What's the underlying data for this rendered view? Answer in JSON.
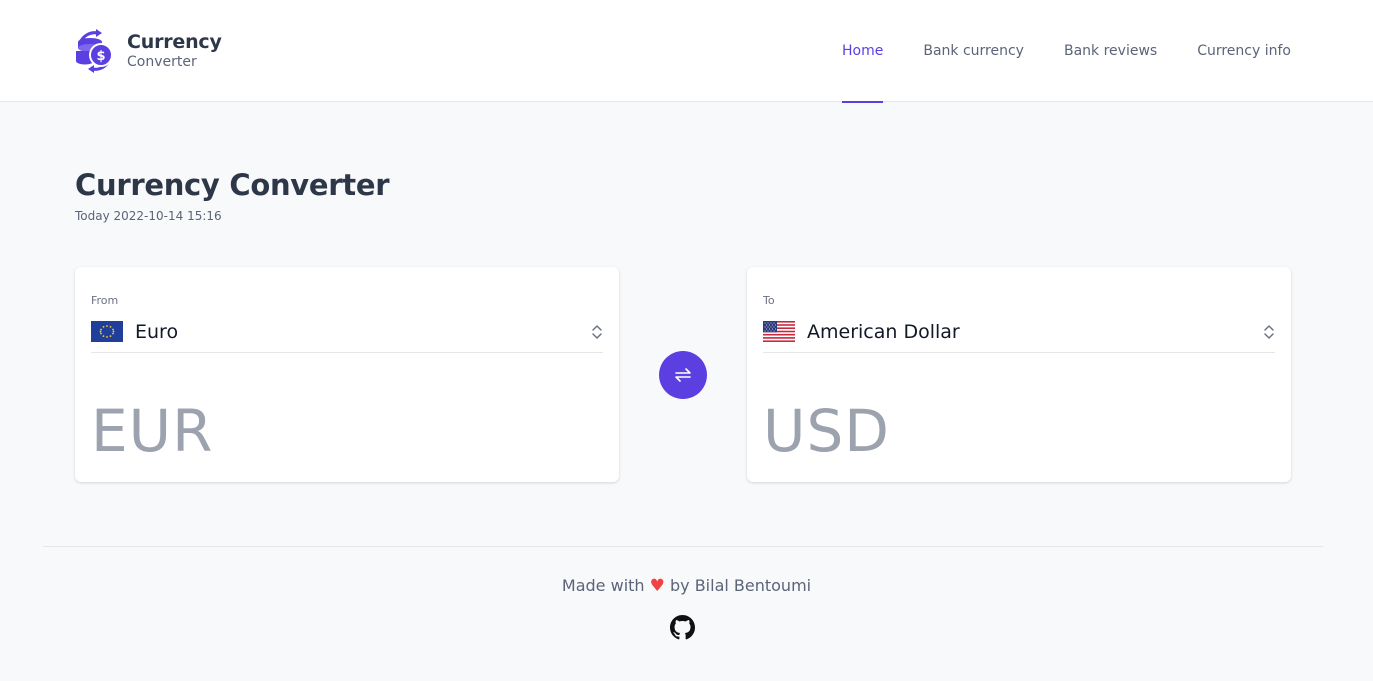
{
  "brand": {
    "title": "Currency",
    "subtitle": "Converter",
    "accent_color": "#5b3fe0",
    "icon": "coins-exchange-icon"
  },
  "nav": {
    "items": [
      {
        "label": "Home",
        "active": true
      },
      {
        "label": "Bank currency",
        "active": false
      },
      {
        "label": "Bank reviews",
        "active": false
      },
      {
        "label": "Currency info",
        "active": false
      }
    ]
  },
  "page": {
    "title": "Currency Converter",
    "date": "Today 2022-10-14 15:16"
  },
  "from": {
    "label": "From",
    "currency_name": "Euro",
    "code": "EUR",
    "flag_icon": "eu-flag-icon"
  },
  "to": {
    "label": "To",
    "currency_name": "American Dollar",
    "code": "USD",
    "flag_icon": "us-flag-icon"
  },
  "swap": {
    "icon": "swap-arrows-icon"
  },
  "footer": {
    "made_with": "Made with",
    "heart": "♥",
    "by": "by Bilal Bentoumi",
    "icon": "github-icon"
  }
}
